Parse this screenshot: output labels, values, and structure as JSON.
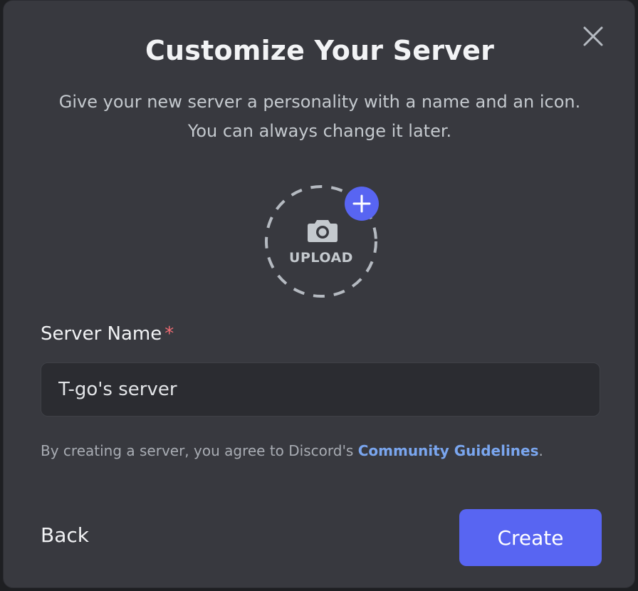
{
  "dialog": {
    "title": "Customize Your Server",
    "subtitle": "Give your new server a personality with a name and an icon. You can always change it later.",
    "close_icon": "close-icon"
  },
  "upload": {
    "label": "UPLOAD",
    "icons": [
      "camera-icon",
      "plus-icon"
    ],
    "accent": "#5865f2"
  },
  "form": {
    "server_name_label": "Server Name",
    "required_marker": "*",
    "server_name_value": "T-go's server"
  },
  "terms": {
    "prefix": "By creating a server, you agree to Discord's ",
    "link_text": "Community Guidelines",
    "suffix": "."
  },
  "footer": {
    "back_label": "Back",
    "create_label": "Create"
  },
  "colors": {
    "modal_bg": "#38393f",
    "input_bg": "#2b2c31",
    "link": "#7aa6ef",
    "required": "#f06c73",
    "primary": "#5865f2"
  }
}
